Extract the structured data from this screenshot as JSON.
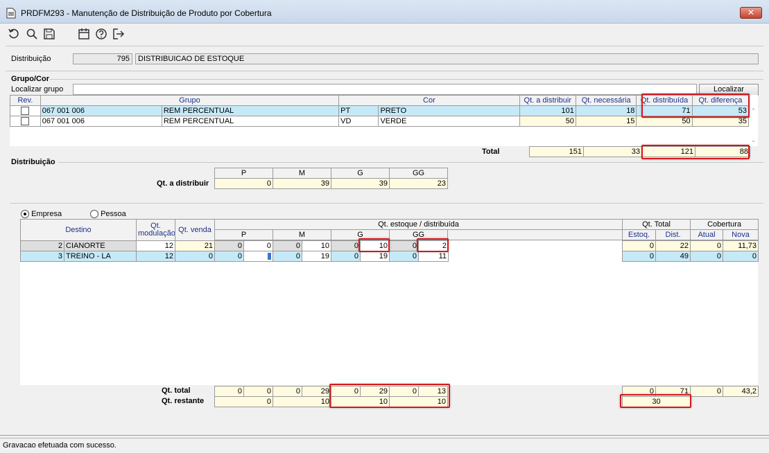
{
  "window": {
    "title": "PRDFM293 - Manutenção de Distribuição de Produto por Cobertura",
    "close_label": "✕"
  },
  "toolbar": {
    "icons": [
      "refresh-icon",
      "search-icon",
      "save-icon",
      "calendar-icon",
      "help-icon",
      "exit-icon"
    ]
  },
  "header": {
    "distribuicao_label": "Distribuição",
    "distribuicao_code": "795",
    "distribuicao_desc": "DISTRIBUICAO DE ESTOQUE"
  },
  "grupo_cor": {
    "section_title": "Grupo/Cor",
    "search_label": "Localizar grupo",
    "search_value": "",
    "search_button": "Localizar",
    "columns": [
      "Rev.",
      "Grupo",
      "Cor",
      "Qt. a distribuir",
      "Qt. necessária",
      "Qt. distribuída",
      "Qt. diferença"
    ],
    "rows": [
      {
        "grupo_code": "067 001 006",
        "grupo_desc": "REM PERCENTUAL",
        "cor_code": "PT",
        "cor_desc": "PRETO",
        "qt_distribuir": "101",
        "qt_necessaria": "18",
        "qt_distribuida": "71",
        "qt_diferenca": "53"
      },
      {
        "grupo_code": "067 001 006",
        "grupo_desc": "REM PERCENTUAL",
        "cor_code": "VD",
        "cor_desc": "VERDE",
        "qt_distribuir": "50",
        "qt_necessaria": "15",
        "qt_distribuida": "50",
        "qt_diferenca": "35"
      }
    ],
    "total_label": "Total",
    "totals": {
      "qt_distribuir": "151",
      "qt_necessaria": "33",
      "qt_distribuida": "121",
      "qt_diferenca": "88"
    }
  },
  "distribuicao": {
    "section_title": "Distribuição",
    "sizes": [
      "P",
      "M",
      "G",
      "GG"
    ],
    "row_label": "Qt. a distribuir",
    "values": [
      "0",
      "39",
      "39",
      "23"
    ]
  },
  "destinos": {
    "radio_empresa": "Empresa",
    "radio_pessoa": "Pessoa",
    "radio_selected": "Empresa",
    "col_destino": "Destino",
    "col_modulacao": "Qt. modulação",
    "col_venda": "Qt. venda",
    "col_estoque_group": "Qt. estoque / distribuída",
    "sizes": [
      "P",
      "M",
      "G",
      "GG"
    ],
    "col_total_group": "Qt. Total",
    "col_estoq": "Estoq.",
    "col_dist": "Dist.",
    "col_cobertura_group": "Cobertura",
    "col_atual": "Atual",
    "col_nova": "Nova",
    "rows": [
      {
        "num": "2",
        "destino": "CIANORTE",
        "modulacao": "12",
        "venda": "21",
        "p_est": "0",
        "p_dist": "0",
        "m_est": "0",
        "m_dist": "10",
        "g_est": "0",
        "g_dist": "10",
        "gg_est": "0",
        "gg_dist": "2",
        "estoq": "0",
        "dist": "22",
        "atual": "0",
        "nova": "11,73"
      },
      {
        "num": "3",
        "destino": "TREINO - LA",
        "modulacao": "12",
        "venda": "0",
        "p_est": "0",
        "p_dist": "",
        "m_est": "0",
        "m_dist": "19",
        "g_est": "0",
        "g_dist": "19",
        "gg_est": "0",
        "gg_dist": "11",
        "estoq": "0",
        "dist": "49",
        "atual": "0",
        "nova": "0"
      }
    ],
    "qt_total_label": "Qt. total",
    "qt_total": {
      "p_est": "0",
      "p_dist": "0",
      "m_est": "0",
      "m_dist": "29",
      "g_est": "0",
      "g_dist": "29",
      "gg_est": "0",
      "gg_dist": "13",
      "estoq": "0",
      "dist": "71",
      "atual": "0",
      "nova": "43,2"
    },
    "qt_restante_label": "Qt. restante",
    "qt_restante": {
      "p": "0",
      "m": "10",
      "g": "10",
      "gg": "10",
      "total": "30"
    }
  },
  "status": {
    "message": "Gravacao efetuada com sucesso."
  },
  "colors": {
    "highlight_border": "#d5161c",
    "selected_row": "#c6e9f7",
    "header_text": "#1d2f8a",
    "editable_cell": "#fffbe0"
  }
}
